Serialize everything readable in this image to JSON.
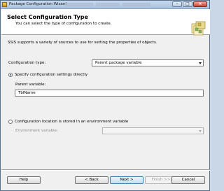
{
  "window": {
    "title": "Package Configuration Wizard",
    "icon": "wizard-app-icon",
    "controls": {
      "minimize": "–",
      "maximize": "□",
      "close": "×"
    }
  },
  "header": {
    "title": "Select Configuration Type",
    "subtitle": "You can select the type of configuration to create.",
    "logo_icon": "configuration-wizard-logo-icon"
  },
  "main": {
    "intro": "SSIS supports a variety of sources to use for setting the properties of objects.",
    "configuration_type_label": "Configuration type:",
    "configuration_type_value": "Parent package variable",
    "option_direct_label": "Specify configuration settings directly",
    "option_direct_selected": true,
    "parent_variable_label": "Parent variable:",
    "parent_variable_value": "TblName",
    "option_env_label": "Configuration location is stored in an environment variable",
    "option_env_selected": false,
    "environment_variable_label": "Environment variable:",
    "environment_variable_value": ""
  },
  "buttons": {
    "help": "Help",
    "back": "< Back",
    "next": "Next >",
    "finish": "Finish >>|",
    "cancel": "Cancel"
  },
  "colors": {
    "window_background": "#f0f0f0",
    "header_background": "#ffffff",
    "titlebar": "#b8cce4",
    "accent": "#3c7fb1"
  }
}
